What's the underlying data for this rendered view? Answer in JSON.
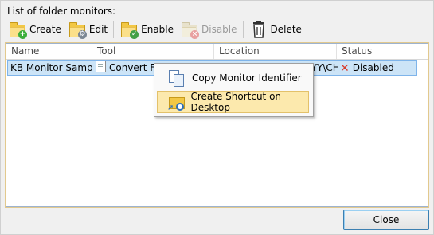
{
  "frame": {
    "title": "List of folder monitors:"
  },
  "toolbar": {
    "create": "Create",
    "edit": "Edit",
    "enable": "Enable",
    "disable": "Disable",
    "delete": "Delete",
    "disable_enabled": false
  },
  "table": {
    "columns": [
      "Name",
      "Tool",
      "Location",
      "Status"
    ],
    "rows": [
      {
        "name": "KB Monitor Sampl",
        "tool": "Convert File to PDF",
        "location": "C:\\Users\\Public\\ABBYY\\CHANGE",
        "status": "Disabled"
      }
    ]
  },
  "context_menu": {
    "items": [
      "Copy Monitor Identifier",
      "Create Shortcut on Desktop"
    ],
    "highlighted": 1
  },
  "buttons": {
    "close": "Close"
  },
  "colors": {
    "selection": "#cce4f7",
    "menu_highlight": "#fce9ad",
    "status_disabled": "#d93a2b"
  }
}
